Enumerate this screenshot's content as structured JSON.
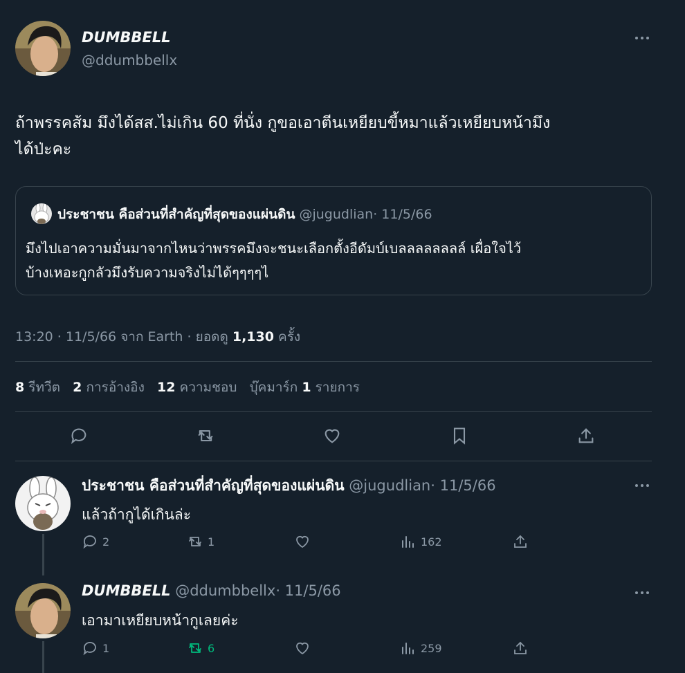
{
  "main_tweet": {
    "author_name": "DUMBBELL",
    "author_handle": "@ddumbbellx",
    "text_line1": "ถ้าพรรคส้ม มึงได้สส.ไม่เกิน 60 ที่นั่ง กูขอเอาตีนเหยียบขี้หมาแล้วเหยียบหน้ามึง",
    "text_line2": "ได้ป่ะคะ",
    "quote": {
      "author_name": "ประชาชน คือส่วนที่สำคัญที่สุดของแผ่นดิน",
      "author_handle": "@jugudlian",
      "date": "· 11/5/66",
      "text_line1": "มึงไปเอาความมั่นมาจากไหนว่าพรรคมึงจะชนะเลือกตั้งอีดัมบ์เบลลลลลลลล์ เผื่อใจไว้",
      "text_line2": "บ้างเหอะกูกลัวมึงรับความจริงไม่ได้ๆๆๆๆไ"
    },
    "meta_prefix": "13:20 · 11/5/66 จาก Earth · ยอดดู",
    "views": "1,130",
    "views_suffix": "ครั้ง",
    "stats": {
      "retweets_count": "8",
      "retweets_label": "รีทวีต",
      "quotes_count": "2",
      "quotes_label": "การอ้างอิง",
      "likes_count": "12",
      "likes_label": "ความชอบ",
      "bookmarks_label": "บุ๊คมาร์ก",
      "bookmarks_count": "1",
      "bookmarks_suffix": "รายการ"
    },
    "action_icons": [
      "reply-icon",
      "retweet-icon",
      "like-icon",
      "bookmark-icon",
      "share-icon"
    ]
  },
  "replies": [
    {
      "author_name": "ประชาชน คือส่วนที่สำคัญที่สุดของแผ่นดิน",
      "author_handle": "@jugudlian",
      "date": "· 11/5/66",
      "text": "แล้วถ้ากูได้เกินล่ะ",
      "reply_count": "2",
      "retweet_count": "1",
      "views": "162"
    },
    {
      "author_name": "DUMBBELL",
      "author_handle": "@ddumbbellx",
      "date": "· 11/5/66",
      "text": "เอามาเหยียบหน้ากูเลยค่ะ",
      "reply_count": "1",
      "retweet_count": "6",
      "views": "259"
    }
  ],
  "colors": {
    "background": "#15202b",
    "text": "#f7f9f9",
    "muted": "#8b98a5",
    "border": "#38444d",
    "retweet_green": "#00ba7c"
  }
}
